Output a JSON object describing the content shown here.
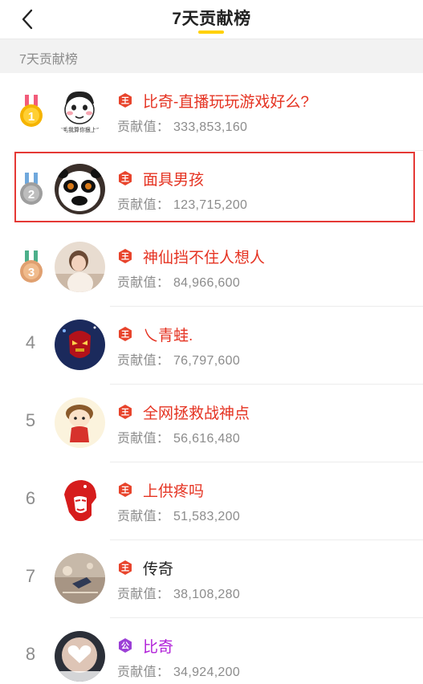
{
  "header": {
    "title": "7天贡献榜",
    "accent_color": "#ffd100"
  },
  "section": {
    "label": "7天贡献榜"
  },
  "score_label": "贡献值：",
  "entries": [
    {
      "rank": "1",
      "medal": "gold",
      "badge": "wang",
      "name": "比奇-直播玩玩游戏好么?",
      "score": "333,853,160",
      "avatar_caption": "\"毛我算你狠上\""
    },
    {
      "rank": "2",
      "medal": "silver",
      "badge": "wang",
      "name": "面具男孩",
      "score": "123,715,200"
    },
    {
      "rank": "3",
      "medal": "bronze",
      "badge": "wang",
      "name": "神仙挡不住人想人",
      "score": "84,966,600"
    },
    {
      "rank": "4",
      "badge": "wang",
      "name": "乀青蛙.",
      "score": "76,797,600"
    },
    {
      "rank": "5",
      "badge": "wang",
      "name": "全网拯救战神点",
      "score": "56,616,480"
    },
    {
      "rank": "6",
      "badge": "wang",
      "name": "上供疼吗",
      "score": "51,583,200"
    },
    {
      "rank": "7",
      "badge": "wang",
      "name": "传奇",
      "score": "38,108,280"
    },
    {
      "rank": "8",
      "badge": "gong",
      "name": "比奇",
      "score": "34,924,200"
    }
  ],
  "colors": {
    "name_red": "#e53322",
    "name_purple": "#b01fd8",
    "selection_border": "#e53935",
    "medal_gold": "#f5b400",
    "medal_silver": "#9e9e9e",
    "medal_bronze": "#e0a070"
  }
}
